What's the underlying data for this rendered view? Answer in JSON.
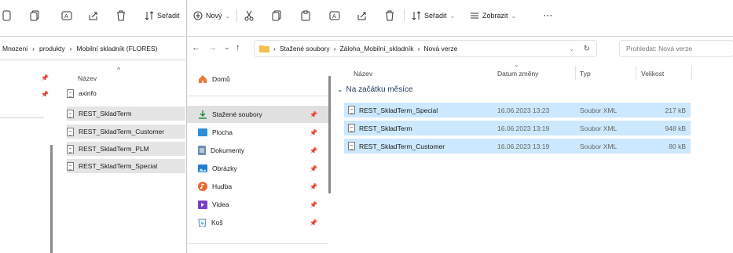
{
  "left": {
    "toolbar": {
      "sort_label": "Seřadit"
    },
    "breadcrumb": [
      "Mnozeni",
      "produkty",
      "Mobilní skladník (FLORES)"
    ],
    "column_header": "Název",
    "files": [
      "axinfo",
      "REST_SkladTerm",
      "REST_SkladTerm_Customer",
      "REST_SkladTerm_PLM",
      "REST_SkladTerm_Special"
    ]
  },
  "right": {
    "toolbar": {
      "new_label": "Nový",
      "sort_label": "Seřadit",
      "view_label": "Zobrazit",
      "more_label": "···"
    },
    "breadcrumb": [
      "Stažené soubory",
      "Záloha_Mobilní_skladník",
      "Nová verze"
    ],
    "search_placeholder": "Prohledat: Nová verze",
    "nav": {
      "home": "Domů",
      "items": [
        {
          "label": "Stažené soubory",
          "icon": "download-icon"
        },
        {
          "label": "Plocha",
          "icon": "desktop-icon"
        },
        {
          "label": "Dokumenty",
          "icon": "documents-icon"
        },
        {
          "label": "Obrázky",
          "icon": "pictures-icon"
        },
        {
          "label": "Hudba",
          "icon": "music-icon"
        },
        {
          "label": "Videa",
          "icon": "videos-icon"
        },
        {
          "label": "Koš",
          "icon": "recycle-bin-icon"
        }
      ]
    },
    "columns": {
      "name": "Název",
      "date": "Datum změny",
      "type": "Typ",
      "size": "Velikost"
    },
    "group_label": "Na začátku měsíce",
    "files": [
      {
        "name": "REST_SkladTerm_Special",
        "date": "16.06.2023 13:23",
        "type": "Soubor XML",
        "size": "217 kB"
      },
      {
        "name": "REST_SkladTerm",
        "date": "16.06.2023 13:19",
        "type": "Soubor XML",
        "size": "948 kB"
      },
      {
        "name": "REST_SkladTerm_Customer",
        "date": "16.06.2023 13:19",
        "type": "Soubor XML",
        "size": "80 kB"
      }
    ]
  },
  "colors": {
    "selection": "#cce8ff",
    "folder": "#f2c14e",
    "accent": "#0067c0"
  }
}
